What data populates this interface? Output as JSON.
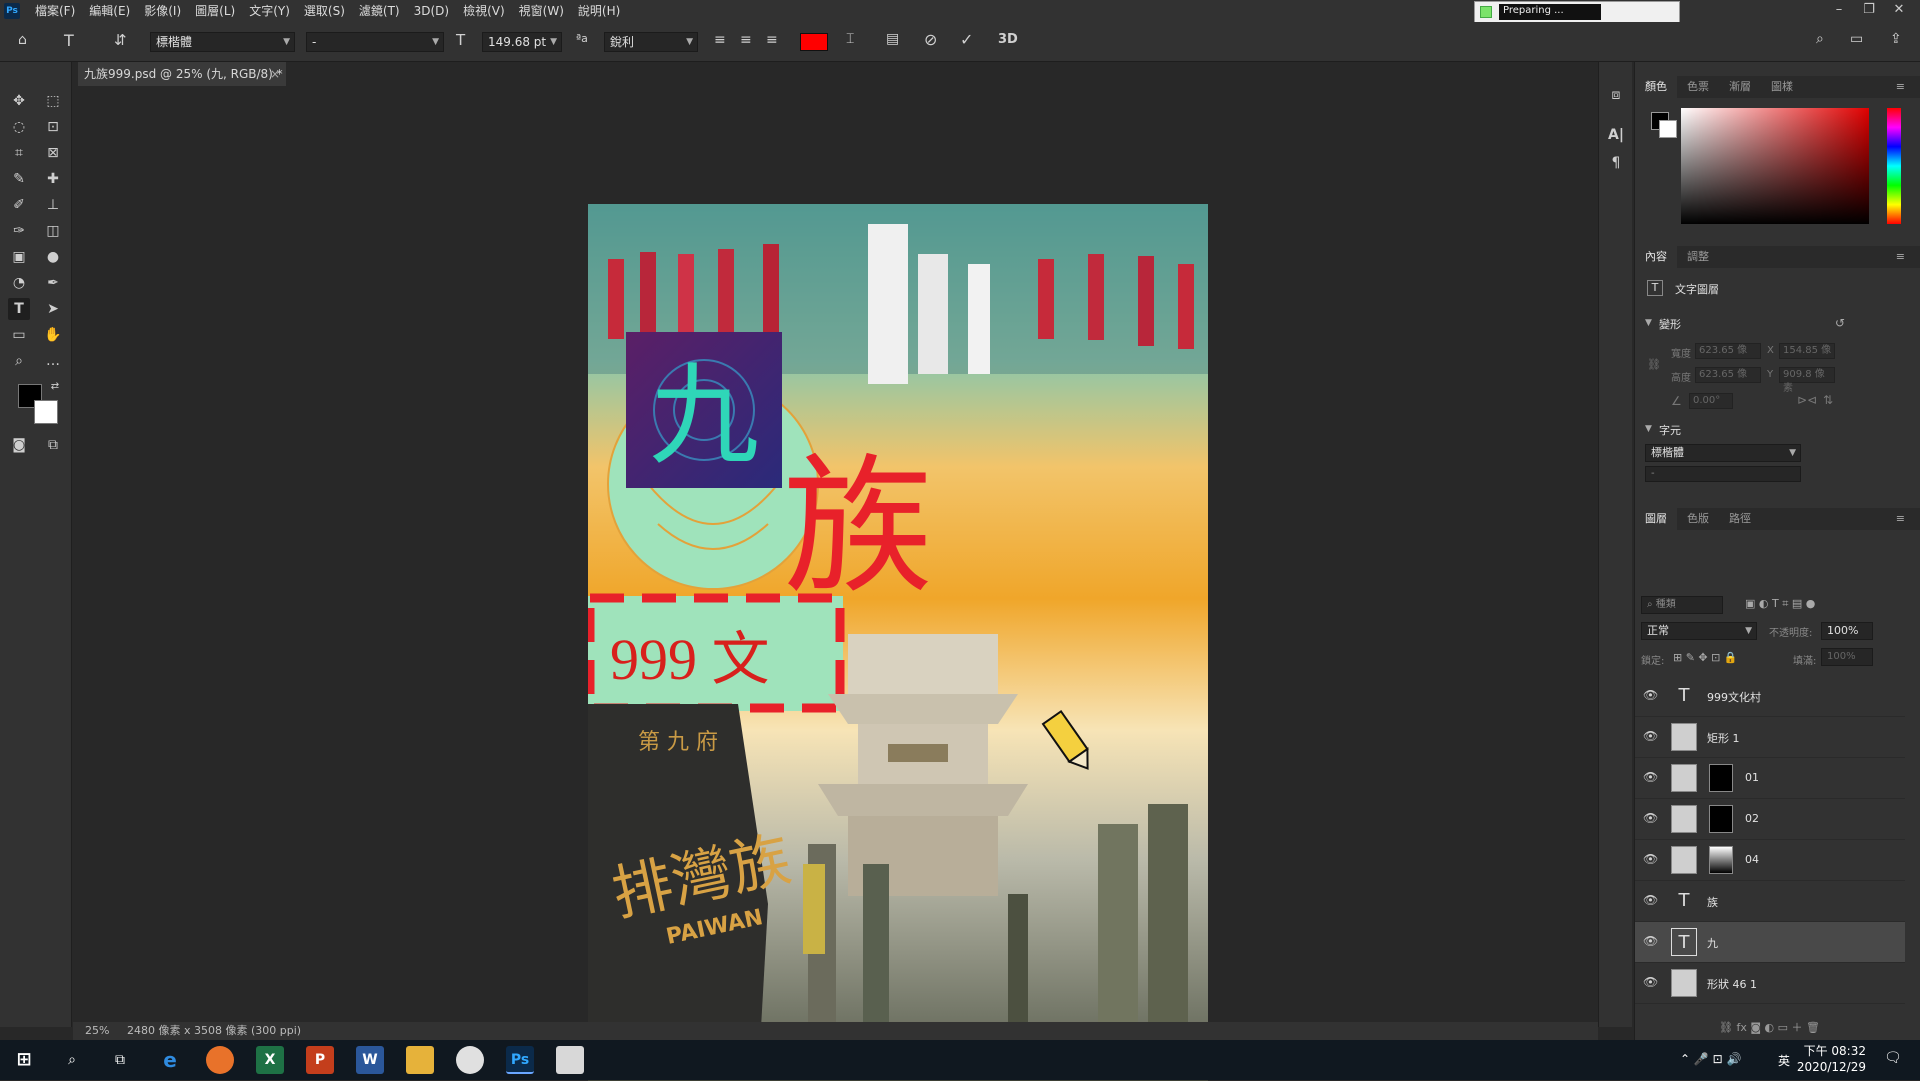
{
  "menubar": {
    "items": [
      "檔案(F)",
      "編輯(E)",
      "影像(I)",
      "圖層(L)",
      "文字(Y)",
      "選取(S)",
      "濾鏡(T)",
      "3D(D)",
      "檢視(V)",
      "視窗(W)",
      "說明(H)"
    ]
  },
  "progress": {
    "label": "Preparing ..."
  },
  "options": {
    "font_family": "標楷體",
    "font_style": "-",
    "font_size": "149.68 pt",
    "antialias": "銳利",
    "color": "#ff0000",
    "label_3d": "3D"
  },
  "document": {
    "tab_title": "九族999.psd @ 25% (九, RGB/8) *",
    "zoom": "25%",
    "info": "2480 像素 x 3508 像素 (300 ppi)"
  },
  "artwork": {
    "char_nine": "九",
    "char_zu": "族",
    "banner_text": "999 文",
    "stone_small": "第 九 府",
    "stone_big": "排灣族",
    "stone_en": "PAIWAN"
  },
  "panels": {
    "color_tabs": [
      "顏色",
      "色票",
      "漸層",
      "圖樣"
    ],
    "props_tabs": [
      "內容",
      "調整"
    ],
    "text_layer_label": "文字圖層",
    "transform_title": "變形",
    "w_label": "寬度",
    "h_label": "高度",
    "w_value": "623.65 像",
    "h_value": "623.65 像",
    "x_label": "X",
    "y_label": "Y",
    "x_value": "154.85 像",
    "y_value": "909.8 像素",
    "angle_value": "0.00°",
    "char_title": "字元",
    "char_font": "標楷體",
    "char_style": "-",
    "layers_tabs": [
      "圖層",
      "色版",
      "路徑"
    ],
    "kind_placeholder": "種類",
    "blend_mode": "正常",
    "opacity_label": "不透明度:",
    "opacity_value": "100%",
    "lock_label": "鎖定:",
    "fill_label": "填滿:",
    "fill_value": "100%"
  },
  "layers": [
    {
      "name": "999文化村",
      "kind": "text"
    },
    {
      "name": "矩形 1",
      "kind": "shape"
    },
    {
      "name": "01",
      "kind": "image-mask"
    },
    {
      "name": "02",
      "kind": "image-mask"
    },
    {
      "name": "04",
      "kind": "image-mask"
    },
    {
      "name": "族",
      "kind": "text"
    },
    {
      "name": "九",
      "kind": "text",
      "selected": true
    },
    {
      "name": "形狀 46 1",
      "kind": "shape"
    }
  ],
  "taskbar": {
    "time": "下午 08:32",
    "date": "2020/12/29",
    "ime": "英"
  }
}
